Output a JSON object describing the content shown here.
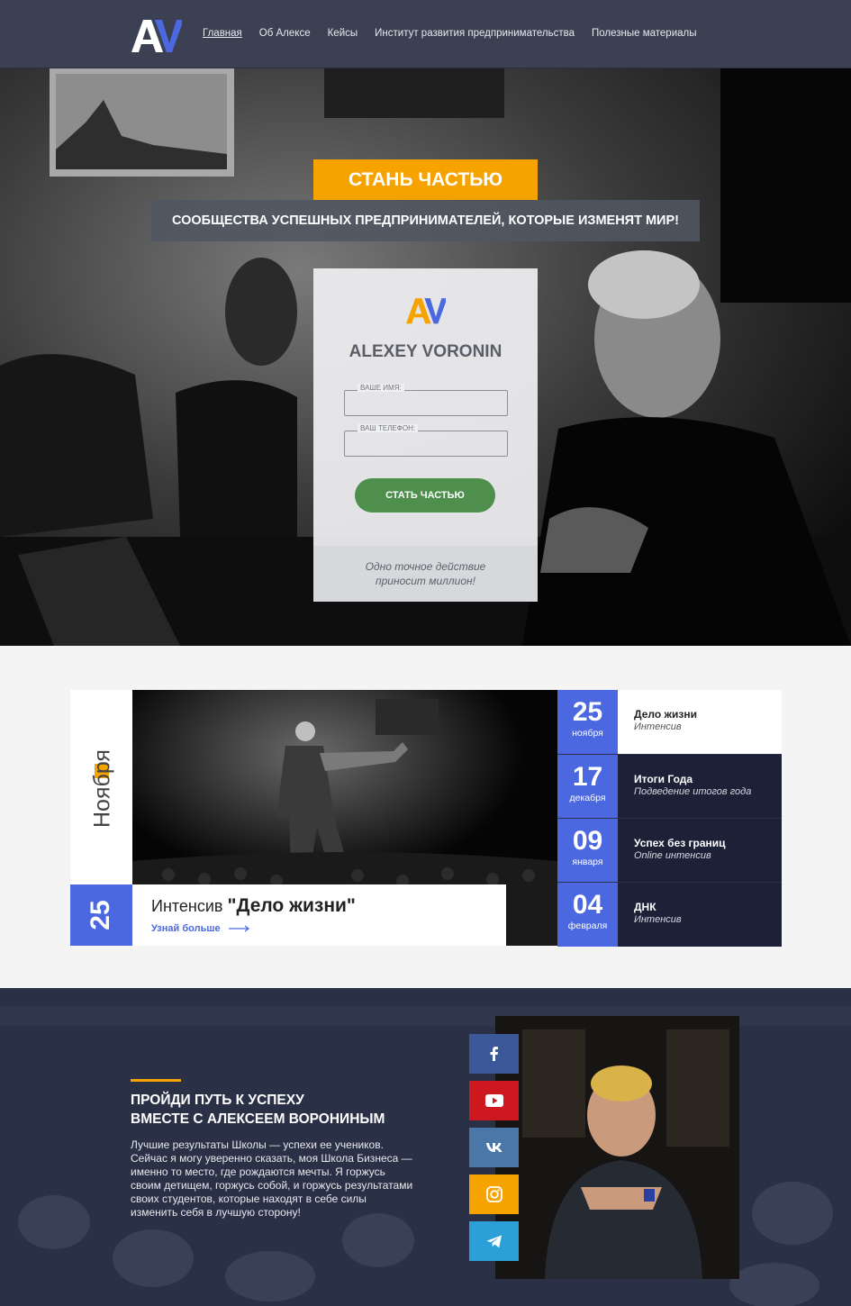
{
  "nav": {
    "logo_text": "AV",
    "links": [
      "Главная",
      "Об Алексе",
      "Кейсы",
      "Институт развития предпринимательства",
      "Полезные материалы"
    ]
  },
  "hero": {
    "badge": "СТАНЬ ЧАСТЬЮ",
    "subtitle": "СООБЩЕСТВА УСПЕШНЫХ ПРЕДПРИНИМАТЕЛЕЙ, КОТОРЫЕ ИЗМЕНЯТ МИР!",
    "form": {
      "logo_text": "AV",
      "brand": "ALEXEY VORONIN",
      "name_label": "ВАШЕ ИМЯ:",
      "phone_label": "ВАШ ТЕЛЕФОН:",
      "button": "СТАТЬ ЧАСТЬЮ",
      "footer_line1": "Одно точное действие",
      "footer_line2": "приносит миллион!"
    }
  },
  "featured": {
    "month": "Ноября",
    "day": "25",
    "kind": "Интенсив",
    "title": "\"Дело жизни\"",
    "more": "Узнай больше"
  },
  "events": [
    {
      "day": "25",
      "month": "ноября",
      "name": "Дело жизни",
      "sub": "Интенсив"
    },
    {
      "day": "17",
      "month": "декабря",
      "name": "Итоги Года",
      "sub": "Подведение итогов года"
    },
    {
      "day": "09",
      "month": "января",
      "name": "Успех без границ",
      "sub": "Online интенсив"
    },
    {
      "day": "04",
      "month": "февраля",
      "name": "ДНК",
      "sub": "Интенсив"
    }
  ],
  "about": {
    "title_line1": "ПРОЙДИ ПУТЬ К УСПЕХУ",
    "title_line2": "ВМЕСТЕ С АЛЕКСЕЕМ ВОРОНИНЫМ",
    "text": "Лучшие результаты Школы — успехи ее учеников. Сейчас я могу уверенно сказать, моя Школа Бизнеса — именно то место, где рождаются мечты. Я горжусь своим детищем, горжусь собой, и горжусь результатами своих студентов, которые находят в себе силы изменить себя в лучшую сторону!"
  },
  "social": [
    {
      "icon": "facebook-icon",
      "color": "#3b5998"
    },
    {
      "icon": "youtube-icon",
      "color": "#cc181e"
    },
    {
      "icon": "vk-icon",
      "color": "#4a76a8"
    },
    {
      "icon": "instagram-icon",
      "color": "#f6a300"
    },
    {
      "icon": "telegram-icon",
      "color": "#2b9fd8"
    }
  ],
  "colors": {
    "accent": "#f6a300",
    "blue": "#4c68e0",
    "navy": "#1d2138",
    "green": "#4e8f4d"
  }
}
